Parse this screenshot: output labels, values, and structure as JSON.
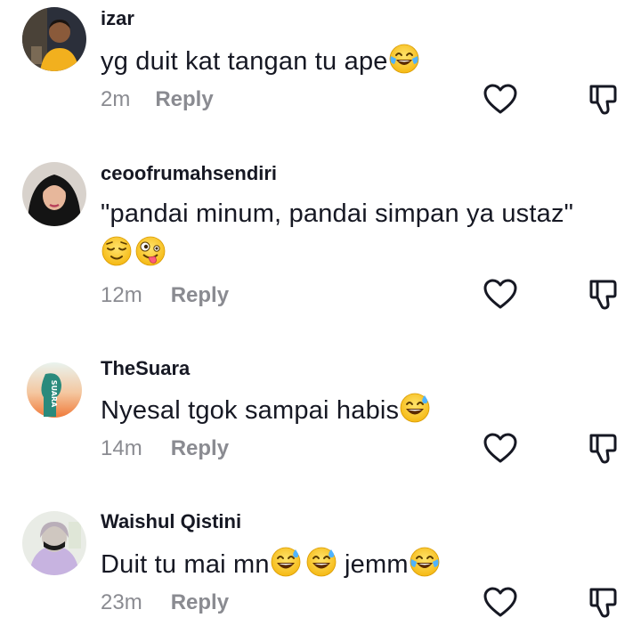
{
  "comments": [
    {
      "username": "izar",
      "text": "yg duit kat tangan tu ape",
      "emojis": [
        "face-with-tears-of-joy"
      ],
      "time": "2m",
      "reply_label": "Reply"
    },
    {
      "username": "ceoofrumahsendiri",
      "text": "\"pandai minum, pandai simpan ya ustaz\"",
      "emojis": [
        "relieved-face",
        "zany-face"
      ],
      "time": "12m",
      "reply_label": "Reply"
    },
    {
      "username": "TheSuara",
      "text": "Nyesal tgok sampai habis",
      "emojis": [
        "grinning-face-with-sweat"
      ],
      "time": "14m",
      "reply_label": "Reply",
      "avatar_text": "SUARA"
    },
    {
      "username": "Waishul Qistini",
      "text_part1": "Duit tu mai mn",
      "text_part2": " jemm",
      "emojis": [
        "grinning-face-with-sweat",
        "grinning-face-with-sweat",
        "face-with-tears-of-joy"
      ],
      "time": "23m",
      "reply_label": "Reply"
    }
  ],
  "icons": {
    "like": "heart-outline-icon",
    "dislike": "thumbs-down-outline-icon"
  },
  "colors": {
    "text": "#161823",
    "meta": "#8a8b91",
    "icon": "#161823",
    "emoji_yellow": "#ffcc33"
  }
}
